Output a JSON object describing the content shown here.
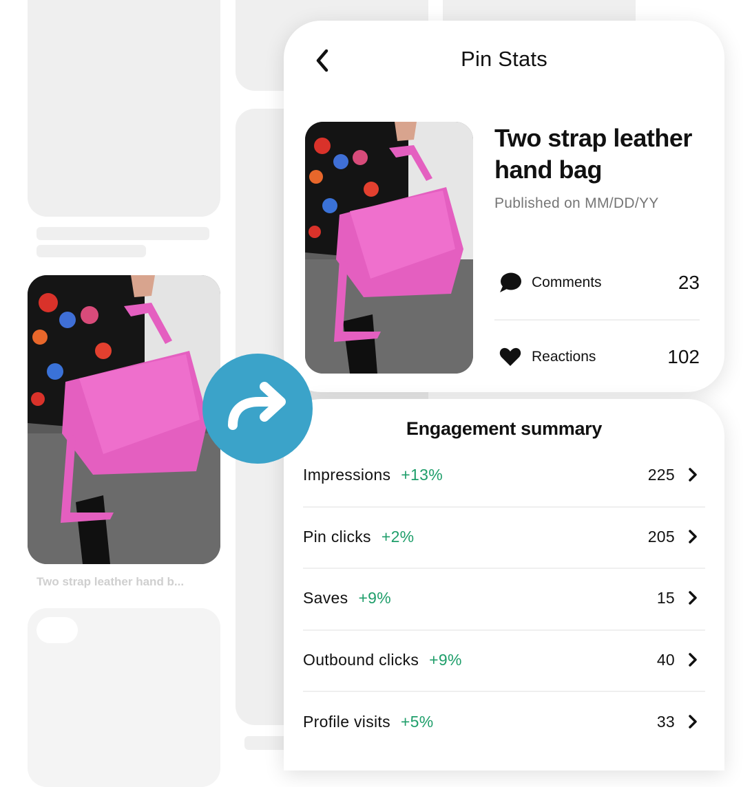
{
  "background_feed": {
    "pin_caption": "Two strap leather hand b..."
  },
  "header": {
    "title": "Pin Stats",
    "back_icon": "chevron-left-icon"
  },
  "pin": {
    "title": "Two strap leather hand bag",
    "published": "Published on MM/DD/YY",
    "image_description": "Pink snakeskin-embossed leather hand bag held by a person in a floral dress"
  },
  "stats": [
    {
      "icon": "comment-icon",
      "label": "Comments",
      "value": "23"
    },
    {
      "icon": "heart-icon",
      "label": "Reactions",
      "value": "102"
    }
  ],
  "engagement": {
    "title": "Engagement summary",
    "rows": [
      {
        "name": "Impressions",
        "delta": "+13%",
        "value": "225"
      },
      {
        "name": "Pin clicks",
        "delta": "+2%",
        "value": "205"
      },
      {
        "name": "Saves",
        "delta": "+9%",
        "value": "15"
      },
      {
        "name": "Outbound clicks",
        "delta": "+9%",
        "value": "40"
      },
      {
        "name": "Profile visits",
        "delta": "+5%",
        "value": "33"
      }
    ]
  },
  "share_button": {
    "icon": "share-arrow-icon"
  },
  "colors": {
    "accent_share": "#3ba3c9",
    "positive_delta": "#1e9e6a",
    "placeholder": "#efefef",
    "secondary_text": "#767676"
  }
}
